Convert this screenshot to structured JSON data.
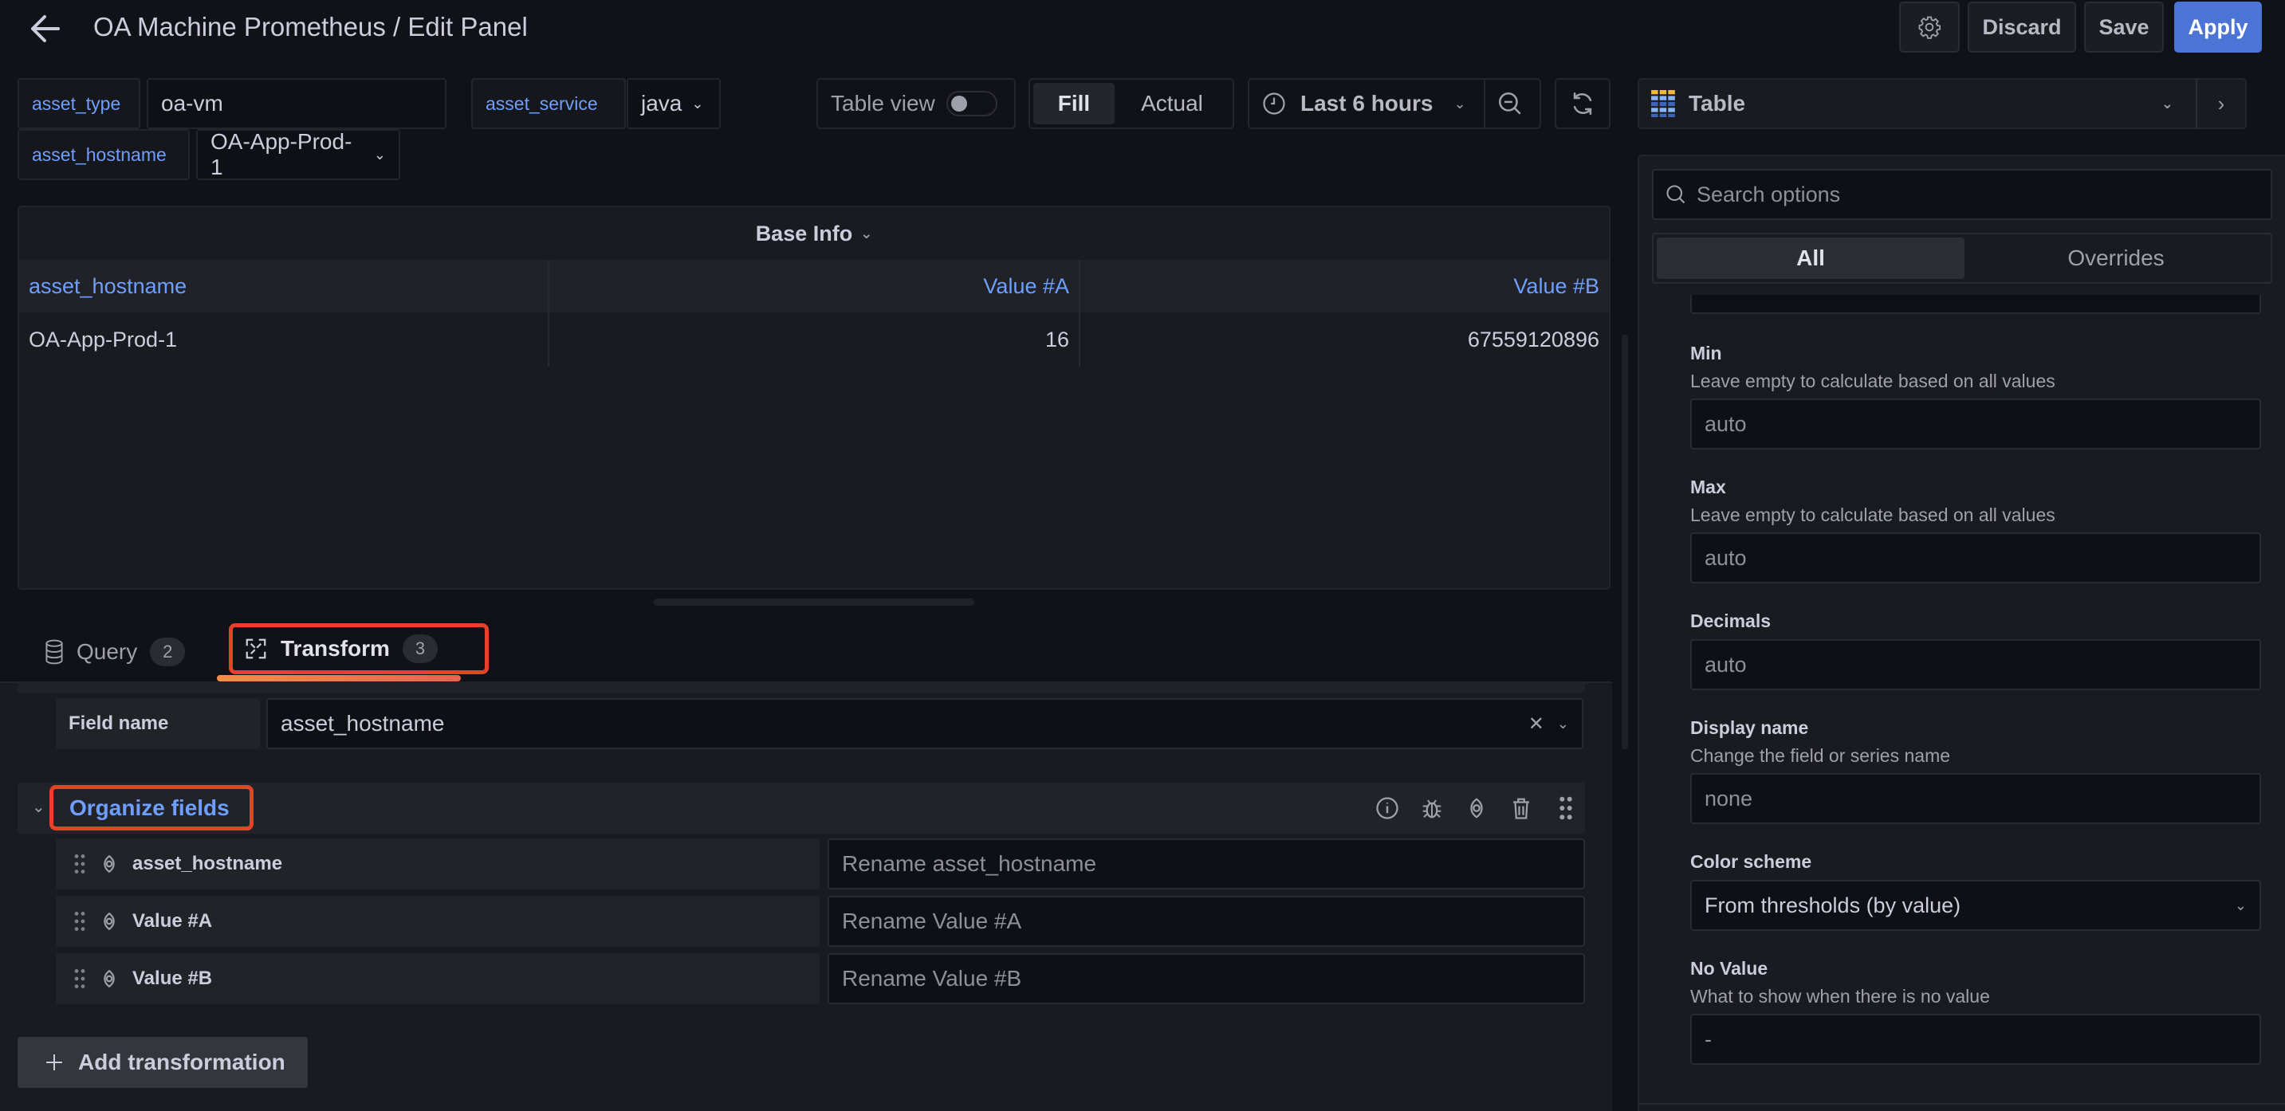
{
  "header": {
    "title": "OA Machine Prometheus / Edit Panel",
    "discard_label": "Discard",
    "save_label": "Save",
    "apply_label": "Apply",
    "apply_color": "#4c74d6"
  },
  "variables": [
    {
      "label": "asset_type",
      "value": "oa-vm",
      "type": "textbox"
    },
    {
      "label": "asset_service",
      "value": "java",
      "type": "dropdown"
    },
    {
      "label": "asset_hostname",
      "value": "OA-App-Prod-1",
      "type": "dropdown"
    }
  ],
  "toolbar": {
    "table_view_label": "Table view",
    "table_view_on": false,
    "fill_label": "Fill",
    "actual_label": "Actual",
    "active_size_mode": "Fill",
    "time_range": "Last 6 hours"
  },
  "panel": {
    "title": "Base Info",
    "columns": [
      "asset_hostname",
      "Value #A",
      "Value #B"
    ],
    "rows": [
      [
        "OA-App-Prod-1",
        "16",
        "67559120896"
      ]
    ]
  },
  "editor_tabs": [
    {
      "label": "Query",
      "count": "2",
      "active": false
    },
    {
      "label": "Transform",
      "count": "3",
      "active": true
    }
  ],
  "transform": {
    "field_name_label": "Field name",
    "field_name_value": "asset_hostname",
    "organize_title": "Organize fields",
    "fields": [
      {
        "name": "asset_hostname",
        "rename_placeholder": "Rename asset_hostname"
      },
      {
        "name": "Value #A",
        "rename_placeholder": "Rename Value #A"
      },
      {
        "name": "Value #B",
        "rename_placeholder": "Rename Value #B"
      }
    ],
    "add_label": "Add transformation"
  },
  "options": {
    "visualization": "Table",
    "search_placeholder": "Search options",
    "tabs": [
      "All",
      "Overrides"
    ],
    "active_tab": "All",
    "min": {
      "label": "Min",
      "desc": "Leave empty to calculate based on all values",
      "placeholder": "auto"
    },
    "max": {
      "label": "Max",
      "desc": "Leave empty to calculate based on all values",
      "placeholder": "auto"
    },
    "decimals": {
      "label": "Decimals",
      "placeholder": "auto"
    },
    "display_name": {
      "label": "Display name",
      "desc": "Change the field or series name",
      "placeholder": "none"
    },
    "color_scheme": {
      "label": "Color scheme",
      "value": "From thresholds (by value)"
    },
    "no_value": {
      "label": "No Value",
      "desc": "What to show when there is no value",
      "placeholder": "-"
    }
  },
  "highlight_color": "#e8412a",
  "accent_text_color": "#6e9fff"
}
